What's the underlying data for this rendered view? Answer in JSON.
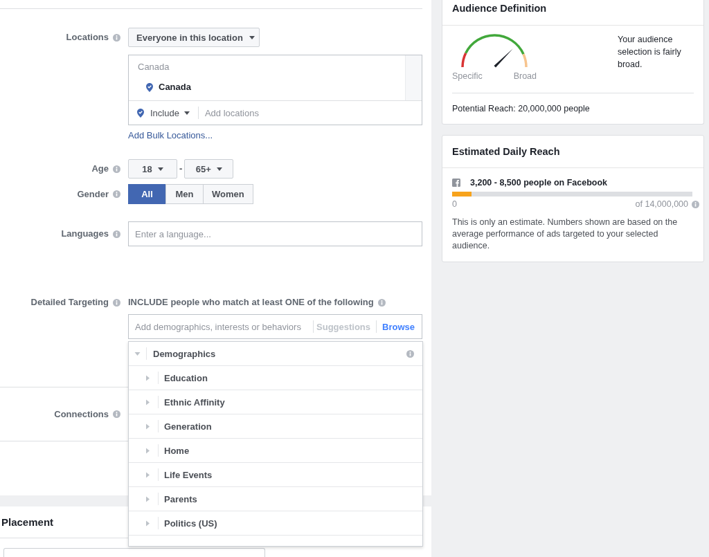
{
  "targeting": {
    "locations": {
      "label": "Locations",
      "mode": "Everyone in this location",
      "group_label": "Canada",
      "items": [
        {
          "name": "Canada"
        }
      ],
      "include_mode": "Include",
      "placeholder": "Add locations",
      "bulk_link": "Add Bulk Locations..."
    },
    "age": {
      "label": "Age",
      "min": "18",
      "separator": "-",
      "max": "65+"
    },
    "gender": {
      "label": "Gender",
      "options": [
        {
          "label": "All",
          "selected": true
        },
        {
          "label": "Men",
          "selected": false
        },
        {
          "label": "Women",
          "selected": false
        }
      ]
    },
    "languages": {
      "label": "Languages",
      "placeholder": "Enter a language..."
    },
    "detailed_targeting": {
      "label": "Detailed Targeting",
      "instruction": "INCLUDE people who match at least ONE of the following",
      "placeholder": "Add demographics, interests or behaviors",
      "tabs": [
        {
          "label": "Suggestions",
          "selected": false
        },
        {
          "label": "Browse",
          "selected": true
        }
      ],
      "browse_tree": [
        {
          "label": "Demographics",
          "expanded": true,
          "children": [
            {
              "label": "Education",
              "expanded": false
            },
            {
              "label": "Ethnic Affinity",
              "expanded": false
            },
            {
              "label": "Generation",
              "expanded": false
            },
            {
              "label": "Home",
              "expanded": false
            },
            {
              "label": "Life Events",
              "expanded": false
            },
            {
              "label": "Parents",
              "expanded": false
            },
            {
              "label": "Politics (US)",
              "expanded": false
            }
          ]
        }
      ]
    },
    "connections": {
      "label": "Connections"
    }
  },
  "placement": {
    "title": "Placement"
  },
  "audience_definition": {
    "title": "Audience Definition",
    "gauge": {
      "level": 0.75,
      "min_label": "Specific",
      "max_label": "Broad"
    },
    "summary": "Your audience selection is fairly broad.",
    "potential_reach": "Potential Reach: 20,000,000 people"
  },
  "estimated_daily_reach": {
    "title": "Estimated Daily Reach",
    "range": "3,200 - 8,500 people on Facebook",
    "meter": {
      "level": 0.08
    },
    "min_label": "0",
    "max_label": "of 14,000,000",
    "note": "This is only an estimate. Numbers shown are based on the average performance of ads targeted to your selected audience."
  }
}
